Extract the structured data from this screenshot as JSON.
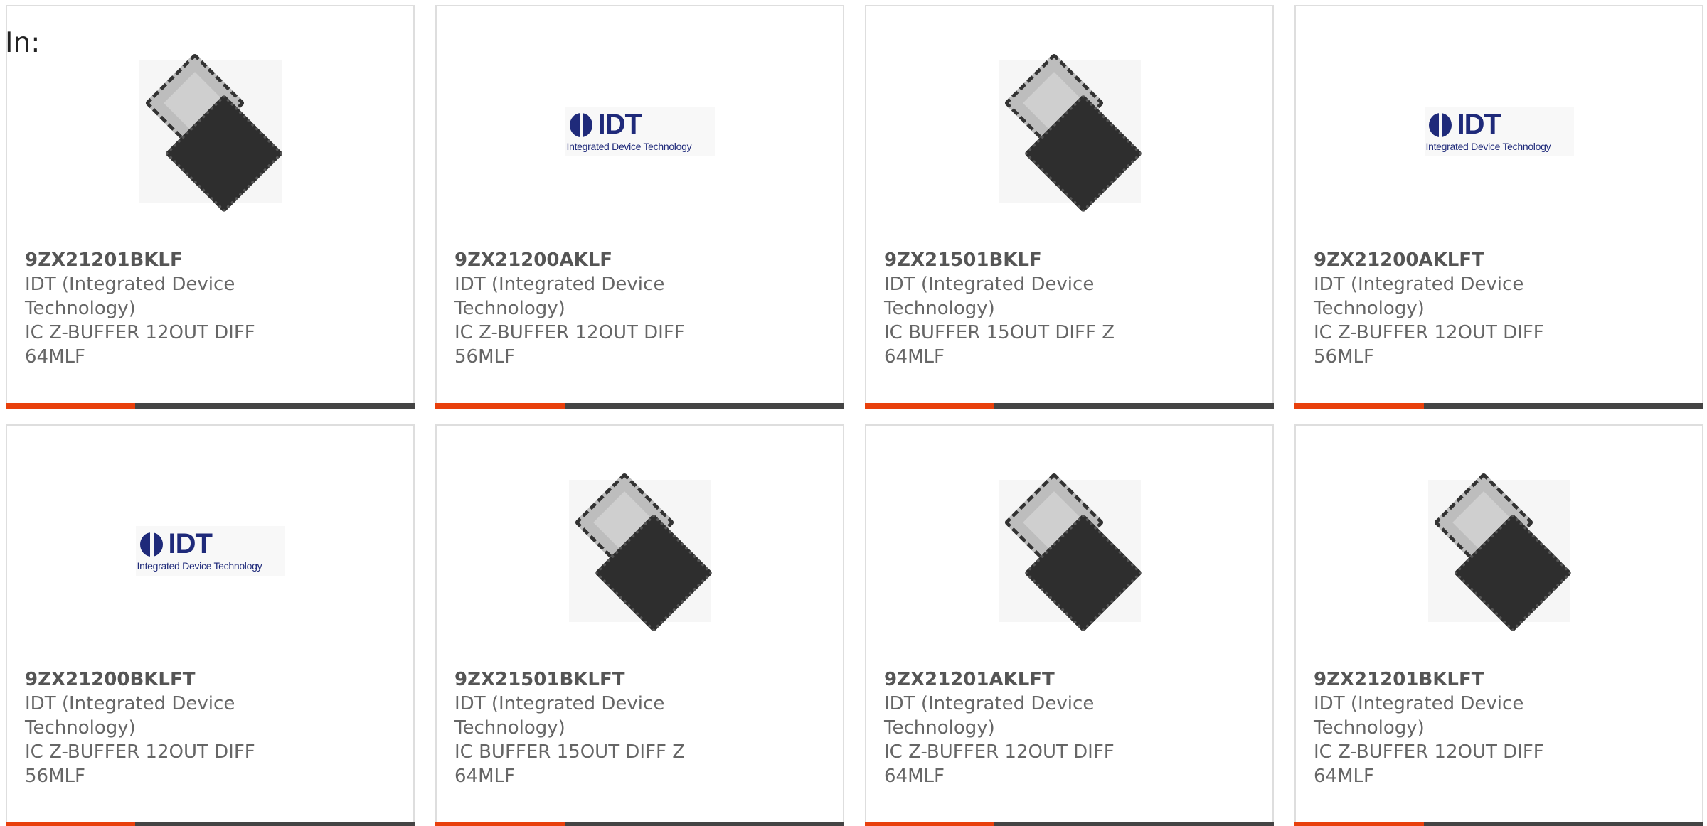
{
  "heading": "In:",
  "colors": {
    "accent": "#e8400c",
    "bar": "#444444",
    "logo_blue": "#1f2a7a"
  },
  "products": [
    {
      "image": "chip-package-icon",
      "part_number": "9ZX21201BKLF",
      "manufacturer": "IDT (Integrated Device Technology)",
      "description": "IC Z-BUFFER 12OUT DIFF 64MLF"
    },
    {
      "image": "idt-logo",
      "part_number": "9ZX21200AKLF",
      "manufacturer": "IDT (Integrated Device Technology)",
      "description": "IC Z-BUFFER 12OUT DIFF 56MLF"
    },
    {
      "image": "chip-package-icon",
      "part_number": "9ZX21501BKLF",
      "manufacturer": "IDT (Integrated Device Technology)",
      "description": "IC BUFFER 15OUT DIFF Z 64MLF"
    },
    {
      "image": "idt-logo",
      "part_number": "9ZX21200AKLFT",
      "manufacturer": "IDT (Integrated Device Technology)",
      "description": "IC Z-BUFFER 12OUT DIFF 56MLF"
    },
    {
      "image": "idt-logo",
      "part_number": "9ZX21200BKLFT",
      "manufacturer": "IDT (Integrated Device Technology)",
      "description": "IC Z-BUFFER 12OUT DIFF 56MLF"
    },
    {
      "image": "chip-package-icon",
      "part_number": "9ZX21501BKLFT",
      "manufacturer": "IDT (Integrated Device Technology)",
      "description": "IC BUFFER 15OUT DIFF Z 64MLF"
    },
    {
      "image": "chip-package-icon",
      "part_number": "9ZX21201AKLFT",
      "manufacturer": "IDT (Integrated Device Technology)",
      "description": "IC Z-BUFFER 12OUT DIFF 64MLF"
    },
    {
      "image": "chip-package-icon",
      "part_number": "9ZX21201BKLFT",
      "manufacturer": "IDT (Integrated Device Technology)",
      "description": "IC Z-BUFFER 12OUT DIFF 64MLF"
    }
  ],
  "logo": {
    "wordmark": "IDT",
    "tagline": "Integrated Device Technology"
  }
}
